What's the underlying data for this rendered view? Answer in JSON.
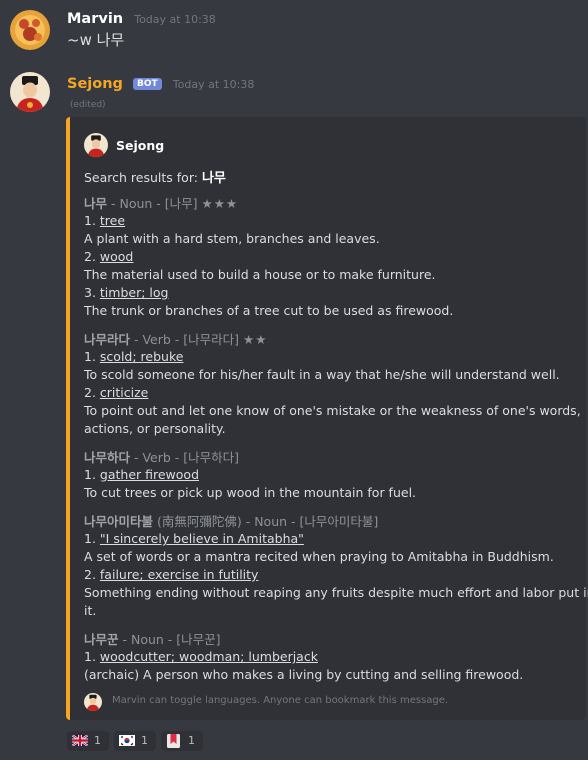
{
  "messages": [
    {
      "author": "Marvin",
      "timestamp": "Today at 10:38",
      "content": "~w 나무"
    },
    {
      "author": "Sejong",
      "bot_badge": "BOT",
      "timestamp": "Today at 10:38",
      "edited": "(edited)",
      "embed": {
        "accent_color": "#f5a623",
        "author": "Sejong",
        "search_prefix": "Search results for:",
        "search_term": "나무",
        "entries": [
          {
            "word": "나무",
            "meta": " - Noun - [나무] ",
            "stars": "★★★",
            "senses": [
              {
                "num": "1. ",
                "term": "tree",
                "def": "A plant with a hard stem, branches and leaves."
              },
              {
                "num": "2. ",
                "term": "wood",
                "def": "The material used to build a house or to make furniture."
              },
              {
                "num": "3. ",
                "term": "timber; log",
                "def": "The trunk or branches of a tree cut to be used as firewood."
              }
            ]
          },
          {
            "word": "나무라다",
            "meta": " - Verb - [나무라다] ",
            "stars": "★★",
            "senses": [
              {
                "num": "1. ",
                "term": "scold; rebuke",
                "def": "To scold someone for his/her fault in a way that he/she will understand well."
              },
              {
                "num": "2. ",
                "term": "criticize",
                "def_lines": [
                  "To point out and let one know of one's mistake or the weakness of one's words,",
                  "actions, or personality."
                ]
              }
            ]
          },
          {
            "word": "나무하다",
            "meta": " - Verb - [나무하다]",
            "senses": [
              {
                "num": "1. ",
                "term": "gather firewood",
                "def": "To cut trees or pick up wood in the mountain for fuel."
              }
            ]
          },
          {
            "word": "나무아미타불",
            "meta": " (南無阿彌陀佛) - Noun - [나무아미타불]",
            "senses": [
              {
                "num": "1. ",
                "term": "\"I sincerely believe in Amitabha\"",
                "def": "A set of words or a mantra recited when praying to Amitabha in Buddhism."
              },
              {
                "num": "2. ",
                "term": "failure; exercise in futility",
                "def_lines": [
                  "Something ending without reaping any fruits despite much effort and labor put into",
                  "it."
                ]
              }
            ]
          },
          {
            "word": "나무꾼",
            "meta": " - Noun - [나무꾼]",
            "senses": [
              {
                "num": "1. ",
                "term": "woodcutter; woodman; lumberjack",
                "def": "(archaic) A person who makes a living by cutting and selling firewood."
              }
            ]
          }
        ],
        "footer": "Marvin can toggle languages. Anyone can bookmark this message."
      },
      "reactions": [
        {
          "icon": "uk-flag-icon",
          "count": "1"
        },
        {
          "icon": "kr-flag-icon",
          "count": "1"
        },
        {
          "icon": "bookmark-icon",
          "count": "1"
        }
      ]
    }
  ],
  "colors": {
    "background": "#36393f",
    "embed_background": "#2f3136",
    "marvin_name": "#ffffff",
    "sejong_name": "#f5a623",
    "bot_badge": "#7289da"
  }
}
